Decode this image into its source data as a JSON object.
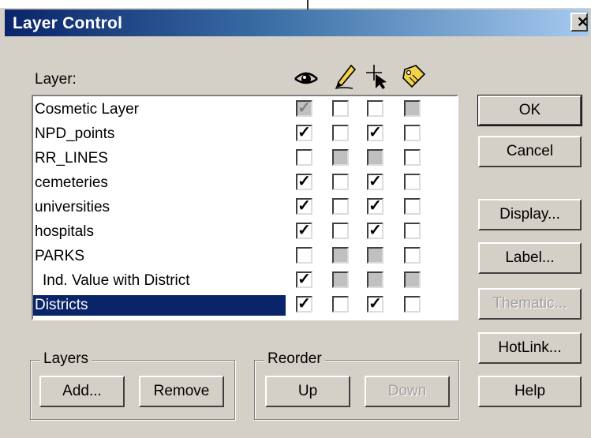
{
  "window": {
    "title": "Layer Control"
  },
  "layer_heading": "Layer:",
  "column_icons": [
    "visible-eye-icon",
    "editable-pencil-icon",
    "selectable-cursor-icon",
    "autolabel-tag-icon"
  ],
  "layers": [
    {
      "name": "Cosmetic Layer",
      "indent": false,
      "selected": false,
      "checks": [
        {
          "checked": true,
          "disabled": true
        },
        {
          "checked": false,
          "disabled": false
        },
        {
          "checked": false,
          "disabled": false
        },
        {
          "checked": false,
          "disabled": true
        }
      ]
    },
    {
      "name": "NPD_points",
      "indent": false,
      "selected": false,
      "checks": [
        {
          "checked": true,
          "disabled": false
        },
        {
          "checked": false,
          "disabled": false
        },
        {
          "checked": true,
          "disabled": false
        },
        {
          "checked": false,
          "disabled": false
        }
      ]
    },
    {
      "name": "RR_LINES",
      "indent": false,
      "selected": false,
      "checks": [
        {
          "checked": false,
          "disabled": false
        },
        {
          "checked": false,
          "disabled": true
        },
        {
          "checked": false,
          "disabled": true
        },
        {
          "checked": false,
          "disabled": false
        }
      ]
    },
    {
      "name": "cemeteries",
      "indent": false,
      "selected": false,
      "checks": [
        {
          "checked": true,
          "disabled": false
        },
        {
          "checked": false,
          "disabled": false
        },
        {
          "checked": true,
          "disabled": false
        },
        {
          "checked": false,
          "disabled": false
        }
      ]
    },
    {
      "name": "universities",
      "indent": false,
      "selected": false,
      "checks": [
        {
          "checked": true,
          "disabled": false
        },
        {
          "checked": false,
          "disabled": false
        },
        {
          "checked": true,
          "disabled": false
        },
        {
          "checked": false,
          "disabled": false
        }
      ]
    },
    {
      "name": "hospitals",
      "indent": false,
      "selected": false,
      "checks": [
        {
          "checked": true,
          "disabled": false
        },
        {
          "checked": false,
          "disabled": false
        },
        {
          "checked": true,
          "disabled": false
        },
        {
          "checked": false,
          "disabled": false
        }
      ]
    },
    {
      "name": "PARKS",
      "indent": false,
      "selected": false,
      "checks": [
        {
          "checked": false,
          "disabled": false
        },
        {
          "checked": false,
          "disabled": true
        },
        {
          "checked": false,
          "disabled": true
        },
        {
          "checked": false,
          "disabled": false
        }
      ]
    },
    {
      "name": "Ind. Value with District",
      "indent": true,
      "selected": false,
      "checks": [
        {
          "checked": true,
          "disabled": false
        },
        {
          "checked": false,
          "disabled": true
        },
        {
          "checked": false,
          "disabled": true
        },
        {
          "checked": false,
          "disabled": true
        }
      ]
    },
    {
      "name": "Districts",
      "indent": false,
      "selected": true,
      "checks": [
        {
          "checked": true,
          "disabled": false
        },
        {
          "checked": false,
          "disabled": false
        },
        {
          "checked": true,
          "disabled": false
        },
        {
          "checked": false,
          "disabled": false
        }
      ]
    }
  ],
  "buttons": {
    "ok": "OK",
    "cancel": "Cancel",
    "display": "Display...",
    "label": "Label...",
    "thematic": "Thematic...",
    "hotlink": "HotLink...",
    "help": "Help"
  },
  "layers_group": {
    "title": "Layers",
    "add": "Add...",
    "remove": "Remove"
  },
  "reorder_group": {
    "title": "Reorder",
    "up": "Up",
    "down": "Down"
  },
  "colors": {
    "face": "#d4d0c8",
    "title_start": "#0a246a",
    "title_end": "#a6caf0",
    "selection": "#0a246a"
  }
}
